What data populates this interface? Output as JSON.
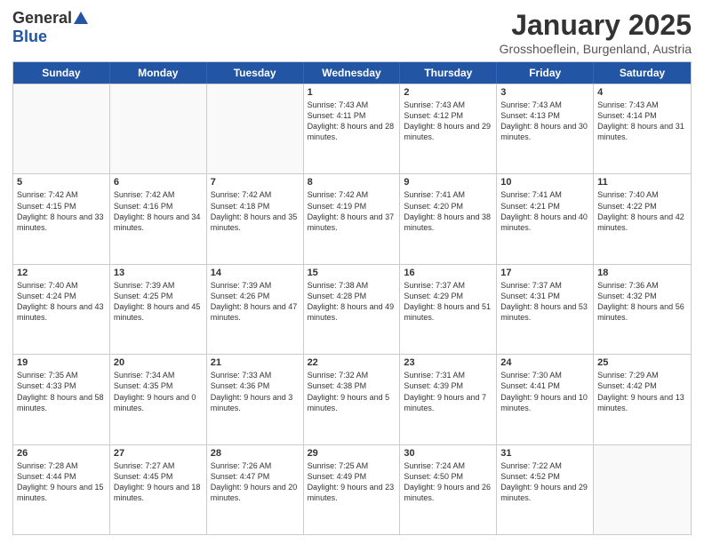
{
  "header": {
    "logo_general": "General",
    "logo_blue": "Blue",
    "title": "January 2025",
    "subtitle": "Grosshoeflein, Burgenland, Austria"
  },
  "days_of_week": [
    "Sunday",
    "Monday",
    "Tuesday",
    "Wednesday",
    "Thursday",
    "Friday",
    "Saturday"
  ],
  "weeks": [
    [
      {
        "day": "",
        "info": "",
        "empty": true
      },
      {
        "day": "",
        "info": "",
        "empty": true
      },
      {
        "day": "",
        "info": "",
        "empty": true
      },
      {
        "day": "1",
        "info": "Sunrise: 7:43 AM\nSunset: 4:11 PM\nDaylight: 8 hours\nand 28 minutes.",
        "empty": false
      },
      {
        "day": "2",
        "info": "Sunrise: 7:43 AM\nSunset: 4:12 PM\nDaylight: 8 hours\nand 29 minutes.",
        "empty": false
      },
      {
        "day": "3",
        "info": "Sunrise: 7:43 AM\nSunset: 4:13 PM\nDaylight: 8 hours\nand 30 minutes.",
        "empty": false
      },
      {
        "day": "4",
        "info": "Sunrise: 7:43 AM\nSunset: 4:14 PM\nDaylight: 8 hours\nand 31 minutes.",
        "empty": false
      }
    ],
    [
      {
        "day": "5",
        "info": "Sunrise: 7:42 AM\nSunset: 4:15 PM\nDaylight: 8 hours\nand 33 minutes.",
        "empty": false
      },
      {
        "day": "6",
        "info": "Sunrise: 7:42 AM\nSunset: 4:16 PM\nDaylight: 8 hours\nand 34 minutes.",
        "empty": false
      },
      {
        "day": "7",
        "info": "Sunrise: 7:42 AM\nSunset: 4:18 PM\nDaylight: 8 hours\nand 35 minutes.",
        "empty": false
      },
      {
        "day": "8",
        "info": "Sunrise: 7:42 AM\nSunset: 4:19 PM\nDaylight: 8 hours\nand 37 minutes.",
        "empty": false
      },
      {
        "day": "9",
        "info": "Sunrise: 7:41 AM\nSunset: 4:20 PM\nDaylight: 8 hours\nand 38 minutes.",
        "empty": false
      },
      {
        "day": "10",
        "info": "Sunrise: 7:41 AM\nSunset: 4:21 PM\nDaylight: 8 hours\nand 40 minutes.",
        "empty": false
      },
      {
        "day": "11",
        "info": "Sunrise: 7:40 AM\nSunset: 4:22 PM\nDaylight: 8 hours\nand 42 minutes.",
        "empty": false
      }
    ],
    [
      {
        "day": "12",
        "info": "Sunrise: 7:40 AM\nSunset: 4:24 PM\nDaylight: 8 hours\nand 43 minutes.",
        "empty": false
      },
      {
        "day": "13",
        "info": "Sunrise: 7:39 AM\nSunset: 4:25 PM\nDaylight: 8 hours\nand 45 minutes.",
        "empty": false
      },
      {
        "day": "14",
        "info": "Sunrise: 7:39 AM\nSunset: 4:26 PM\nDaylight: 8 hours\nand 47 minutes.",
        "empty": false
      },
      {
        "day": "15",
        "info": "Sunrise: 7:38 AM\nSunset: 4:28 PM\nDaylight: 8 hours\nand 49 minutes.",
        "empty": false
      },
      {
        "day": "16",
        "info": "Sunrise: 7:37 AM\nSunset: 4:29 PM\nDaylight: 8 hours\nand 51 minutes.",
        "empty": false
      },
      {
        "day": "17",
        "info": "Sunrise: 7:37 AM\nSunset: 4:31 PM\nDaylight: 8 hours\nand 53 minutes.",
        "empty": false
      },
      {
        "day": "18",
        "info": "Sunrise: 7:36 AM\nSunset: 4:32 PM\nDaylight: 8 hours\nand 56 minutes.",
        "empty": false
      }
    ],
    [
      {
        "day": "19",
        "info": "Sunrise: 7:35 AM\nSunset: 4:33 PM\nDaylight: 8 hours\nand 58 minutes.",
        "empty": false
      },
      {
        "day": "20",
        "info": "Sunrise: 7:34 AM\nSunset: 4:35 PM\nDaylight: 9 hours\nand 0 minutes.",
        "empty": false
      },
      {
        "day": "21",
        "info": "Sunrise: 7:33 AM\nSunset: 4:36 PM\nDaylight: 9 hours\nand 3 minutes.",
        "empty": false
      },
      {
        "day": "22",
        "info": "Sunrise: 7:32 AM\nSunset: 4:38 PM\nDaylight: 9 hours\nand 5 minutes.",
        "empty": false
      },
      {
        "day": "23",
        "info": "Sunrise: 7:31 AM\nSunset: 4:39 PM\nDaylight: 9 hours\nand 7 minutes.",
        "empty": false
      },
      {
        "day": "24",
        "info": "Sunrise: 7:30 AM\nSunset: 4:41 PM\nDaylight: 9 hours\nand 10 minutes.",
        "empty": false
      },
      {
        "day": "25",
        "info": "Sunrise: 7:29 AM\nSunset: 4:42 PM\nDaylight: 9 hours\nand 13 minutes.",
        "empty": false
      }
    ],
    [
      {
        "day": "26",
        "info": "Sunrise: 7:28 AM\nSunset: 4:44 PM\nDaylight: 9 hours\nand 15 minutes.",
        "empty": false
      },
      {
        "day": "27",
        "info": "Sunrise: 7:27 AM\nSunset: 4:45 PM\nDaylight: 9 hours\nand 18 minutes.",
        "empty": false
      },
      {
        "day": "28",
        "info": "Sunrise: 7:26 AM\nSunset: 4:47 PM\nDaylight: 9 hours\nand 20 minutes.",
        "empty": false
      },
      {
        "day": "29",
        "info": "Sunrise: 7:25 AM\nSunset: 4:49 PM\nDaylight: 9 hours\nand 23 minutes.",
        "empty": false
      },
      {
        "day": "30",
        "info": "Sunrise: 7:24 AM\nSunset: 4:50 PM\nDaylight: 9 hours\nand 26 minutes.",
        "empty": false
      },
      {
        "day": "31",
        "info": "Sunrise: 7:22 AM\nSunset: 4:52 PM\nDaylight: 9 hours\nand 29 minutes.",
        "empty": false
      },
      {
        "day": "",
        "info": "",
        "empty": true
      }
    ]
  ]
}
